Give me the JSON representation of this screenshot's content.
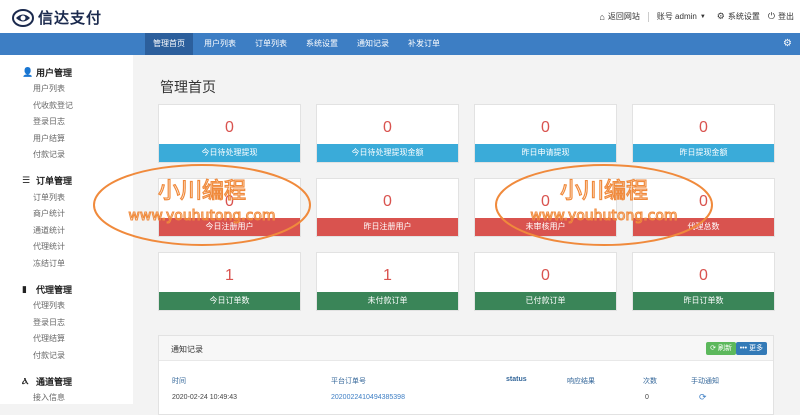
{
  "header": {
    "logo_text": "信达支付",
    "back_site": "返回网站",
    "account": "账号 admin",
    "settings": "系统设置",
    "logout": "登出"
  },
  "nav": {
    "items": [
      "管理首页",
      "用户列表",
      "订单列表",
      "系统设置",
      "通知记录",
      "补发订单"
    ],
    "active_index": 0
  },
  "sidebar": {
    "groups": [
      {
        "title": "用户管理",
        "icon": "user-icon",
        "items": [
          "用户列表",
          "代收款登记",
          "登录日志",
          "用户结算",
          "付款记录"
        ]
      },
      {
        "title": "订单管理",
        "icon": "list-icon",
        "items": [
          "订单列表",
          "商户统计",
          "通道统计",
          "代理统计",
          "冻结订单"
        ]
      },
      {
        "title": "代理管理",
        "icon": "file-icon",
        "items": [
          "代理列表",
          "登录日志",
          "代理结算",
          "付款记录"
        ]
      },
      {
        "title": "通道管理",
        "icon": "road-icon",
        "items": [
          "接入信息"
        ]
      }
    ]
  },
  "main": {
    "title": "管理首页",
    "cards": [
      {
        "value": "0",
        "label": "今日待处理提现",
        "color": "blue"
      },
      {
        "value": "0",
        "label": "今日待处理提现金额",
        "color": "blue"
      },
      {
        "value": "0",
        "label": "昨日申请提现",
        "color": "blue"
      },
      {
        "value": "0",
        "label": "昨日提现金额",
        "color": "blue"
      },
      {
        "value": "0",
        "label": "今日注册用户",
        "color": "red"
      },
      {
        "value": "0",
        "label": "昨日注册用户",
        "color": "red"
      },
      {
        "value": "0",
        "label": "未审核用户",
        "color": "red"
      },
      {
        "value": "0",
        "label": "代理总数",
        "color": "red"
      },
      {
        "value": "1",
        "label": "今日订单数",
        "color": "green"
      },
      {
        "value": "1",
        "label": "未付款订单",
        "color": "green"
      },
      {
        "value": "0",
        "label": "已付款订单",
        "color": "green"
      },
      {
        "value": "0",
        "label": "昨日订单数",
        "color": "green"
      }
    ],
    "notify_panel": {
      "title": "通知记录",
      "refresh_label": "刷新",
      "more_label": "更多",
      "columns": [
        "时间",
        "平台订单号",
        "status",
        "响应结果",
        "次数",
        "手动通知"
      ],
      "rows": [
        {
          "time": "2020-02-24 10:49:43",
          "order_no": "2020022410494385398",
          "status": "",
          "response": "",
          "count": "0"
        }
      ]
    }
  },
  "watermark": {
    "line1": "小川编程",
    "line2": "www.youhutong.com"
  },
  "colors": {
    "nav": "#3d7ec4",
    "blue": "#3aabd9",
    "red": "#d9534f",
    "green": "#3a8558"
  }
}
